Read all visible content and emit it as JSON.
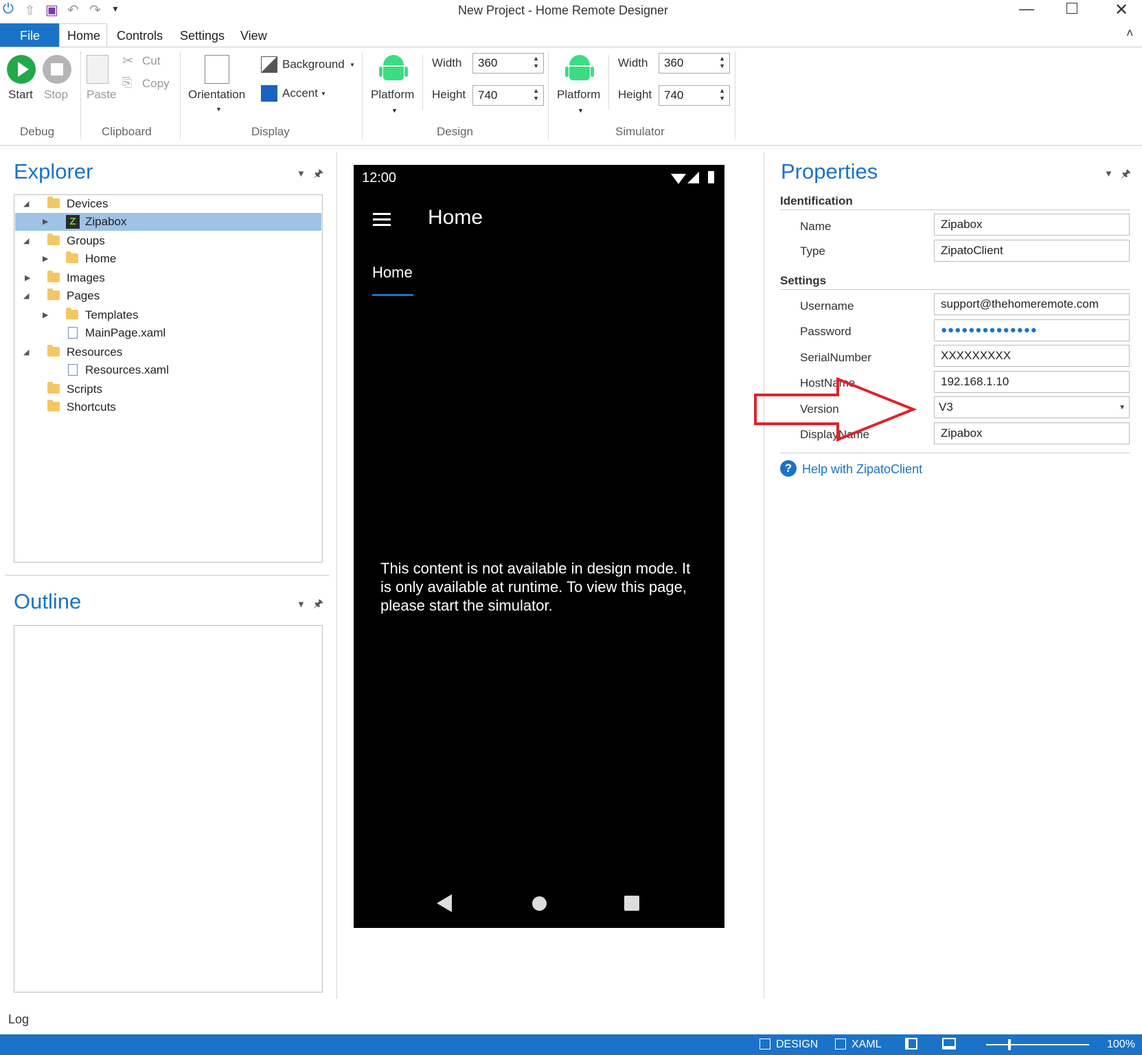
{
  "window": {
    "title": "New Project - Home Remote Designer"
  },
  "menu": {
    "file": "File",
    "tabs": [
      "Home",
      "Controls",
      "Settings",
      "View"
    ]
  },
  "ribbon": {
    "debug": {
      "start": "Start",
      "stop": "Stop",
      "group": "Debug"
    },
    "clipboard": {
      "paste": "Paste",
      "cut": "Cut",
      "copy": "Copy",
      "group": "Clipboard"
    },
    "display": {
      "orientation": "Orientation",
      "background": "Background",
      "accent": "Accent",
      "group": "Display",
      "accent_color": "#1565c0"
    },
    "design": {
      "platform": "Platform",
      "width_label": "Width",
      "width": "360",
      "height_label": "Height",
      "height": "740",
      "group": "Design"
    },
    "simulator": {
      "platform": "Platform",
      "width_label": "Width",
      "width": "360",
      "height_label": "Height",
      "height": "740",
      "group": "Simulator"
    }
  },
  "explorer": {
    "title": "Explorer",
    "tree": [
      {
        "label": "Devices"
      },
      {
        "label": "Zipabox"
      },
      {
        "label": "Groups"
      },
      {
        "label": "Home"
      },
      {
        "label": "Images"
      },
      {
        "label": "Pages"
      },
      {
        "label": "Templates"
      },
      {
        "label": "MainPage.xaml"
      },
      {
        "label": "Resources"
      },
      {
        "label": "Resources.xaml"
      },
      {
        "label": "Scripts"
      },
      {
        "label": "Shortcuts"
      }
    ]
  },
  "outline": {
    "title": "Outline"
  },
  "phone": {
    "time": "12:00",
    "app_title": "Home",
    "tab": "Home",
    "message": "This content is not available in design mode. It is only available at runtime. To view this page, please start the simulator."
  },
  "properties": {
    "title": "Properties",
    "identification": "Identification",
    "name_label": "Name",
    "name": "Zipabox",
    "type_label": "Type",
    "type": "ZipatoClient",
    "settings": "Settings",
    "username_label": "Username",
    "username": "support@thehomeremote.com",
    "password_label": "Password",
    "password": "●●●●●●●●●●●●●●",
    "serial_label": "SerialNumber",
    "serial": "XXXXXXXXX",
    "hostname_label": "HostName",
    "hostname": "192.168.1.10",
    "version_label": "Version",
    "version": "V3",
    "displayname_label": "DisplayName",
    "displayname": "Zipabox",
    "help": "Help with ZipatoClient"
  },
  "log": {
    "label": "Log"
  },
  "statusbar": {
    "design": "DESIGN",
    "xaml": "XAML",
    "zoom": "100%"
  },
  "colors": {
    "accent": "#1a73c8",
    "statusbar": "#1a73c8",
    "annotation_arrow": "#e0222a"
  }
}
